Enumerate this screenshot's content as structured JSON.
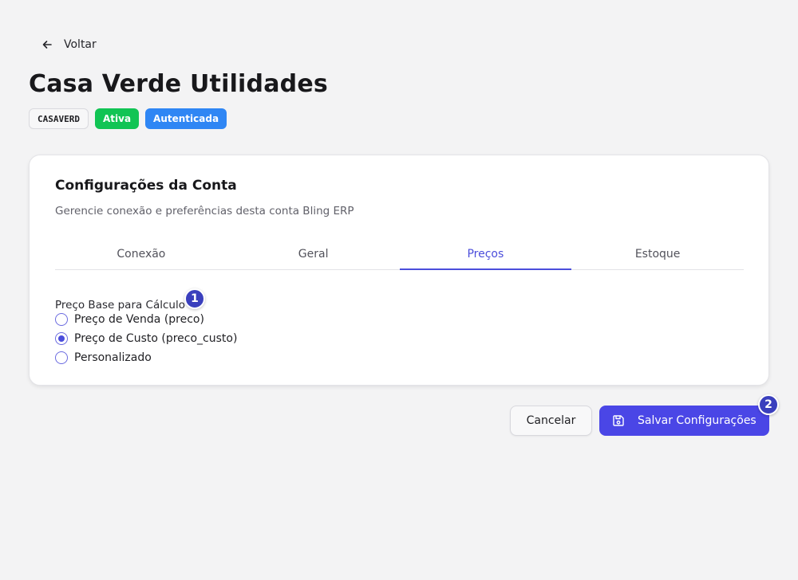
{
  "header": {
    "back_label": "Voltar",
    "title": "Casa Verde Utilidades",
    "badges": {
      "code": "CASAVERD",
      "status": "Ativa",
      "auth": "Autenticada"
    }
  },
  "card": {
    "title": "Configurações da Conta",
    "subtitle": "Gerencie conexão e preferências desta conta Bling ERP",
    "tabs": [
      {
        "label": "Conexão"
      },
      {
        "label": "Geral"
      },
      {
        "label": "Preços",
        "selected": true
      },
      {
        "label": "Estoque"
      }
    ],
    "price_base": {
      "label": "Preço Base para Cálculo",
      "options": [
        {
          "label": "Preço de Venda (preco)",
          "checked": false
        },
        {
          "label": "Preço de Custo (preco_custo)",
          "checked": true
        },
        {
          "label": "Personalizado",
          "checked": false
        }
      ]
    }
  },
  "actions": {
    "cancel_label": "Cancelar",
    "save_label": "Salvar Configurações"
  },
  "markers": {
    "one": "1",
    "two": "2"
  },
  "colors": {
    "accent": "#4a46e6",
    "status_active": "#11c454",
    "status_auth": "#2f86f4",
    "marker": "#3a3fbd"
  },
  "icons": {
    "back": "arrow-left-icon",
    "save": "floppy-disk-icon"
  }
}
